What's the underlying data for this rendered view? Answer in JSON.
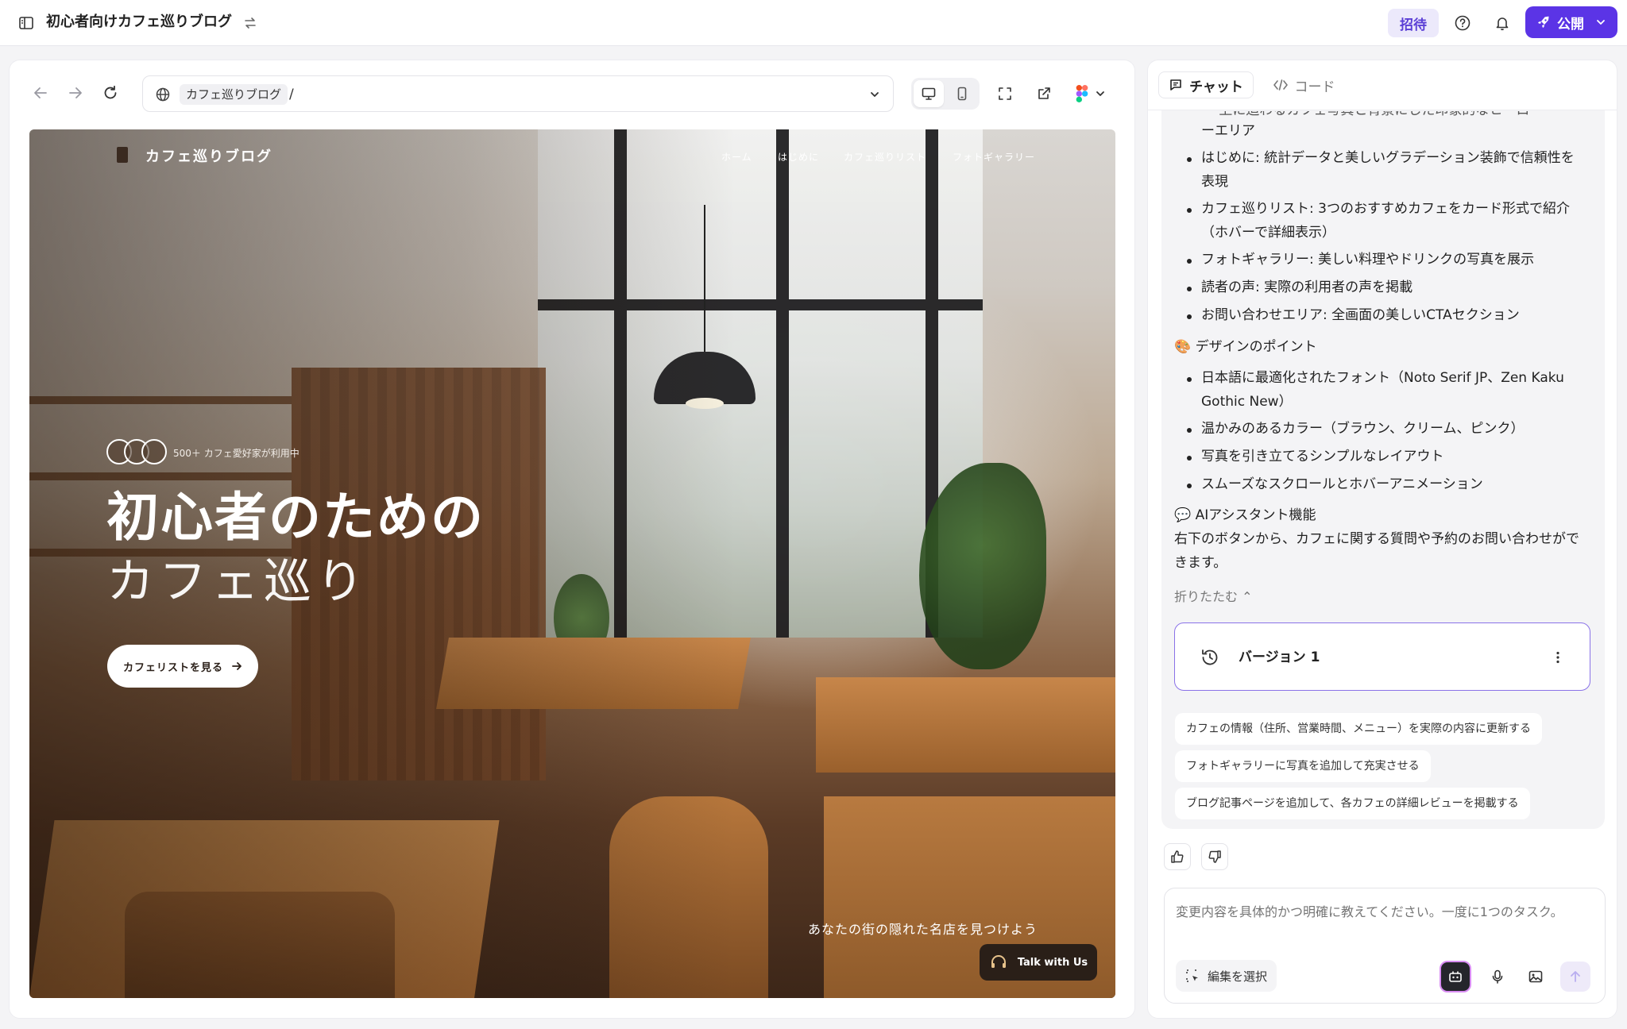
{
  "topbar": {
    "project_title": "初心者向けカフェ巡りブログ",
    "invite_label": "招待",
    "publish_label": "公開",
    "accent": "#5b34e6"
  },
  "browser": {
    "url_chip": "カフェ巡りブログ",
    "url_path": "/"
  },
  "site": {
    "logo": "カフェ巡りブログ",
    "nav": [
      "ホーム",
      "はじめに",
      "カフェ巡りリスト",
      "フォトギャラリー"
    ],
    "users_text": "500＋ カフェ愛好家が利用中",
    "headline_line1": "初心者のための",
    "headline_line2": "カフェ巡り",
    "cta_label": "カフェリストを見る",
    "tagline": "あなたの街の隠れた名店を見つけよう",
    "talk_label": "Talk with Us"
  },
  "chat": {
    "tab_chat": "チャット",
    "tab_code": "コード",
    "messages": {
      "cut_top": "・ 上に迫わるカフェ写真と背景にした印象的なヒーロー",
      "cut_top2": "ーエリア",
      "b1a": "はじめに: 統計データと美しいグラデーション装飾で信頼性を",
      "b1b": "表現",
      "b2a": "カフェ巡りリスト: 3つのおすすめカフェをカード形式で紹介",
      "b2b": "（ホバーで詳細表示）",
      "b3": "フォトギャラリー: 美しい料理やドリンクの写真を展示",
      "b4": "読者の声: 実際の利用者の声を掲載",
      "b5": "お問い合わせエリア: 全画面の美しいCTAセクション",
      "design_heading": "🎨 デザインのポイント",
      "d1a": "日本語に最適化されたフォント（Noto Serif JP、Zen Kaku",
      "d1b": "Gothic New）",
      "d2": "温かみのあるカラー（ブラウン、クリーム、ピンク）",
      "d3": "写真を引き立てるシンプルなレイアウト",
      "d4": "スムーズなスクロールとホバーアニメーション",
      "ai_heading": "💬 AIアシスタント機能",
      "ai_text1": "右下のボタンから、カフェに関する質問や予約のお問い合わせがで",
      "ai_text2": "きます。",
      "collapse": "折りたたむ ⌃"
    },
    "version_label": "バージョン 1",
    "suggestions": [
      "カフェの情報（住所、営業時間、メニュー）を実際の内容に更新する",
      "フォトギャラリーに写真を追加して充実させる",
      "ブログ記事ページを追加して、各カフェの詳細レビューを掲載する"
    ],
    "composer_placeholder": "変更内容を具体的かつ明確に教えてください。一度に1つのタスク。",
    "select_edit_label": "編集を選択"
  }
}
